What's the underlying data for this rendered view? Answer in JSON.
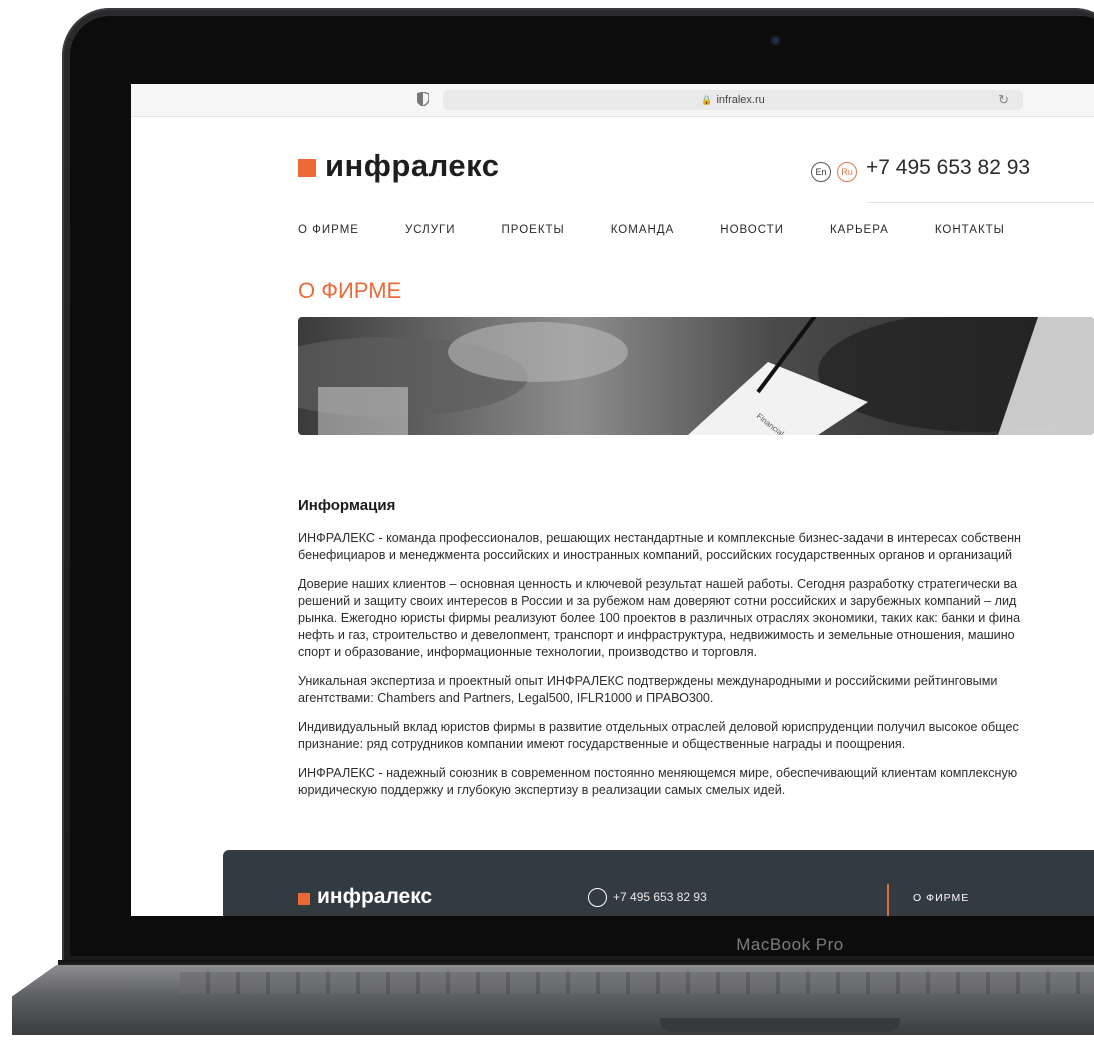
{
  "device": {
    "label": "MacBook Pro"
  },
  "browser": {
    "url": "infralex.ru"
  },
  "site": {
    "logo": "инфралекс",
    "lang_en": "En",
    "lang_ru": "Ru",
    "phone": "+7 495 653 82 93",
    "nav": [
      "О ФИРМЕ",
      "УСЛУГИ",
      "ПРОЕКТЫ",
      "КОМАНДА",
      "НОВОСТИ",
      "КАРЬЕРА",
      "КОНТАКТЫ"
    ],
    "page_title": "О ФИРМЕ",
    "hero_caption": "Financial plan"
  },
  "info": {
    "heading": "Информация",
    "paragraphs": [
      "ИНФРАЛЕКС - команда профессионалов, решающих нестандартные и комплексные бизнес-задачи в интересах собственн\nбенефициаров и менеджмента российских и иностранных компаний, российских государственных органов и организаций",
      "Доверие наших клиентов – основная ценность и ключевой результат нашей работы. Сегодня разработку стратегически ва\nрешений и защиту своих интересов в России и за рубежом нам доверяют сотни российских и зарубежных компаний – лид\nрынка. Ежегодно юристы фирмы реализуют более 100 проектов в различных отраслях экономики, таких как: банки и фина\nнефть и газ, строительство и девелопмент, транспорт и инфраструктура, недвижимость и земельные отношения, машино\nспорт и образование, информационные технологии, производство и торговля.",
      "Уникальная экспертиза и проектный опыт ИНФРАЛЕКС подтверждены международными и российскими рейтинговыми\nагентствами: Chambers and Partners, Legal500, IFLR1000 и ПРАВО300.",
      "Индивидуальный вклад юристов фирмы в развитие отдельных отраслей деловой юриспруденции получил высокое общес\nпризнание: ряд сотрудников компании имеют государственные и общественные награды и поощрения.",
      "ИНФРАЛЕКС - надежный союзник в современном постоянно меняющемся мире, обеспечивающий клиентам комплексную\nюридическую поддержку и глубокую экспертизу в реализации самых смелых идей."
    ]
  },
  "footer": {
    "logo": "инфралекс",
    "phone": "+7 495 653 82 93",
    "nav_item": "О ФИРМЕ"
  },
  "colors": {
    "accent": "#ec6a35",
    "footer_bg": "#323a42"
  }
}
